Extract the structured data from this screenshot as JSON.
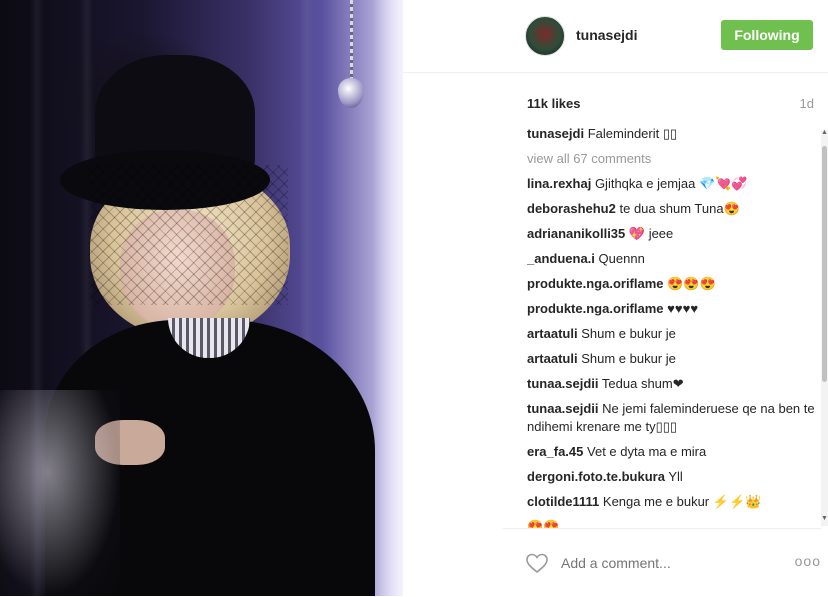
{
  "post": {
    "username": "tunasejdi",
    "follow_label": "Following",
    "likes": "11k likes",
    "time_ago": "1d",
    "caption": {
      "user": "tunasejdi",
      "text": "Faleminderit ▯▯"
    },
    "view_all": "view all 67 comments"
  },
  "comments": [
    {
      "user": "lina.rexhaj",
      "text": "Gjithqka e jemjaa 💎💘💞"
    },
    {
      "user": "deborashehu2",
      "text": "te dua shum Tuna😍"
    },
    {
      "user": "adriananikolli35",
      "text": "💖 jeee"
    },
    {
      "user": "_anduena.i",
      "text": "Quennn"
    },
    {
      "user": "produkte.nga.oriflame",
      "text": "😍😍😍"
    },
    {
      "user": "produkte.nga.oriflame",
      "text": "♥♥♥♥"
    },
    {
      "user": "artaatuli",
      "text": "Shum e bukur je"
    },
    {
      "user": "artaatuli",
      "text": "Shum e bukur je"
    },
    {
      "user": "tunaa.sejdii",
      "text": "Tedua shum❤"
    },
    {
      "user": "tunaa.sejdii",
      "text": "Ne jemi faleminderuese qe na ben te ndihemi krenare me ty▯▯▯"
    },
    {
      "user": "era_fa.45",
      "text": "Vet e dyta ma e mira"
    },
    {
      "user": "dergoni.foto.te.bukura",
      "text": "Yll"
    },
    {
      "user": "clotilde1111",
      "text": "Kenga me e bukur ⚡⚡👑"
    },
    {
      "user": "",
      "text": "😍😍"
    }
  ],
  "footer": {
    "add_comment_placeholder": "Add a comment...",
    "more_label": "ooo"
  },
  "colors": {
    "follow_button": "#70c050",
    "muted_text": "#999999"
  },
  "icons": [
    "heart-outline-icon",
    "more-options-icon"
  ]
}
